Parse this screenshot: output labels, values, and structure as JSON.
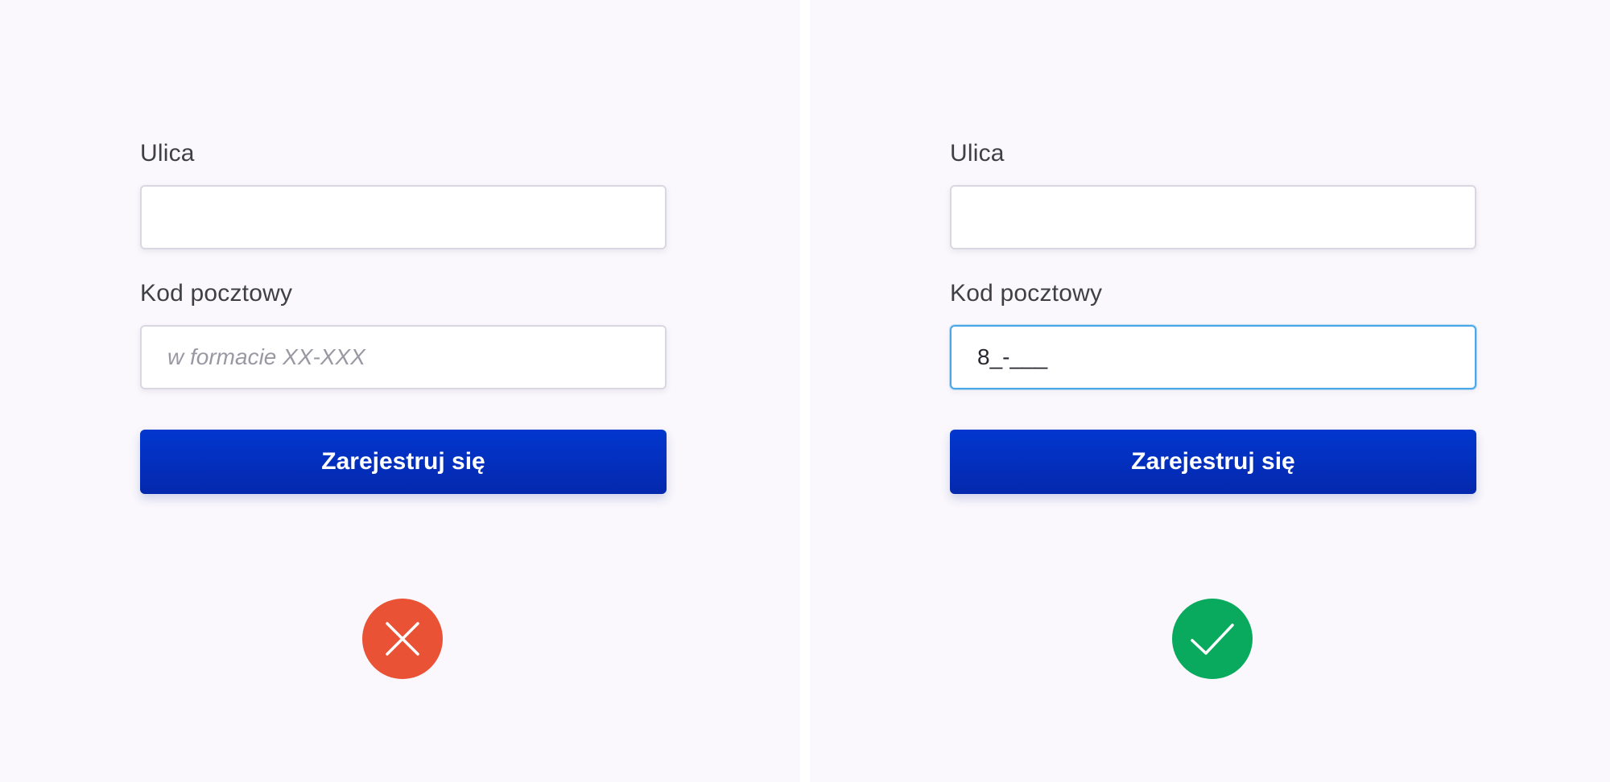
{
  "panels": {
    "bad": {
      "street_label": "Ulica",
      "street_value": "",
      "zip_label": "Kod pocztowy",
      "zip_placeholder": "w formacie XX-XXX",
      "zip_value": "",
      "submit_label": "Zarejestruj się",
      "badge_icon": "cross-icon",
      "badge_color": "#ea5235"
    },
    "good": {
      "street_label": "Ulica",
      "street_value": "",
      "zip_label": "Kod pocztowy",
      "zip_value": "8_-___",
      "submit_label": "Zarejestruj się",
      "badge_icon": "check-icon",
      "badge_color": "#09aa5e"
    }
  },
  "colors": {
    "background": "#faf8fc",
    "button": "#0331c0",
    "focus_border": "#4aa8e8"
  }
}
